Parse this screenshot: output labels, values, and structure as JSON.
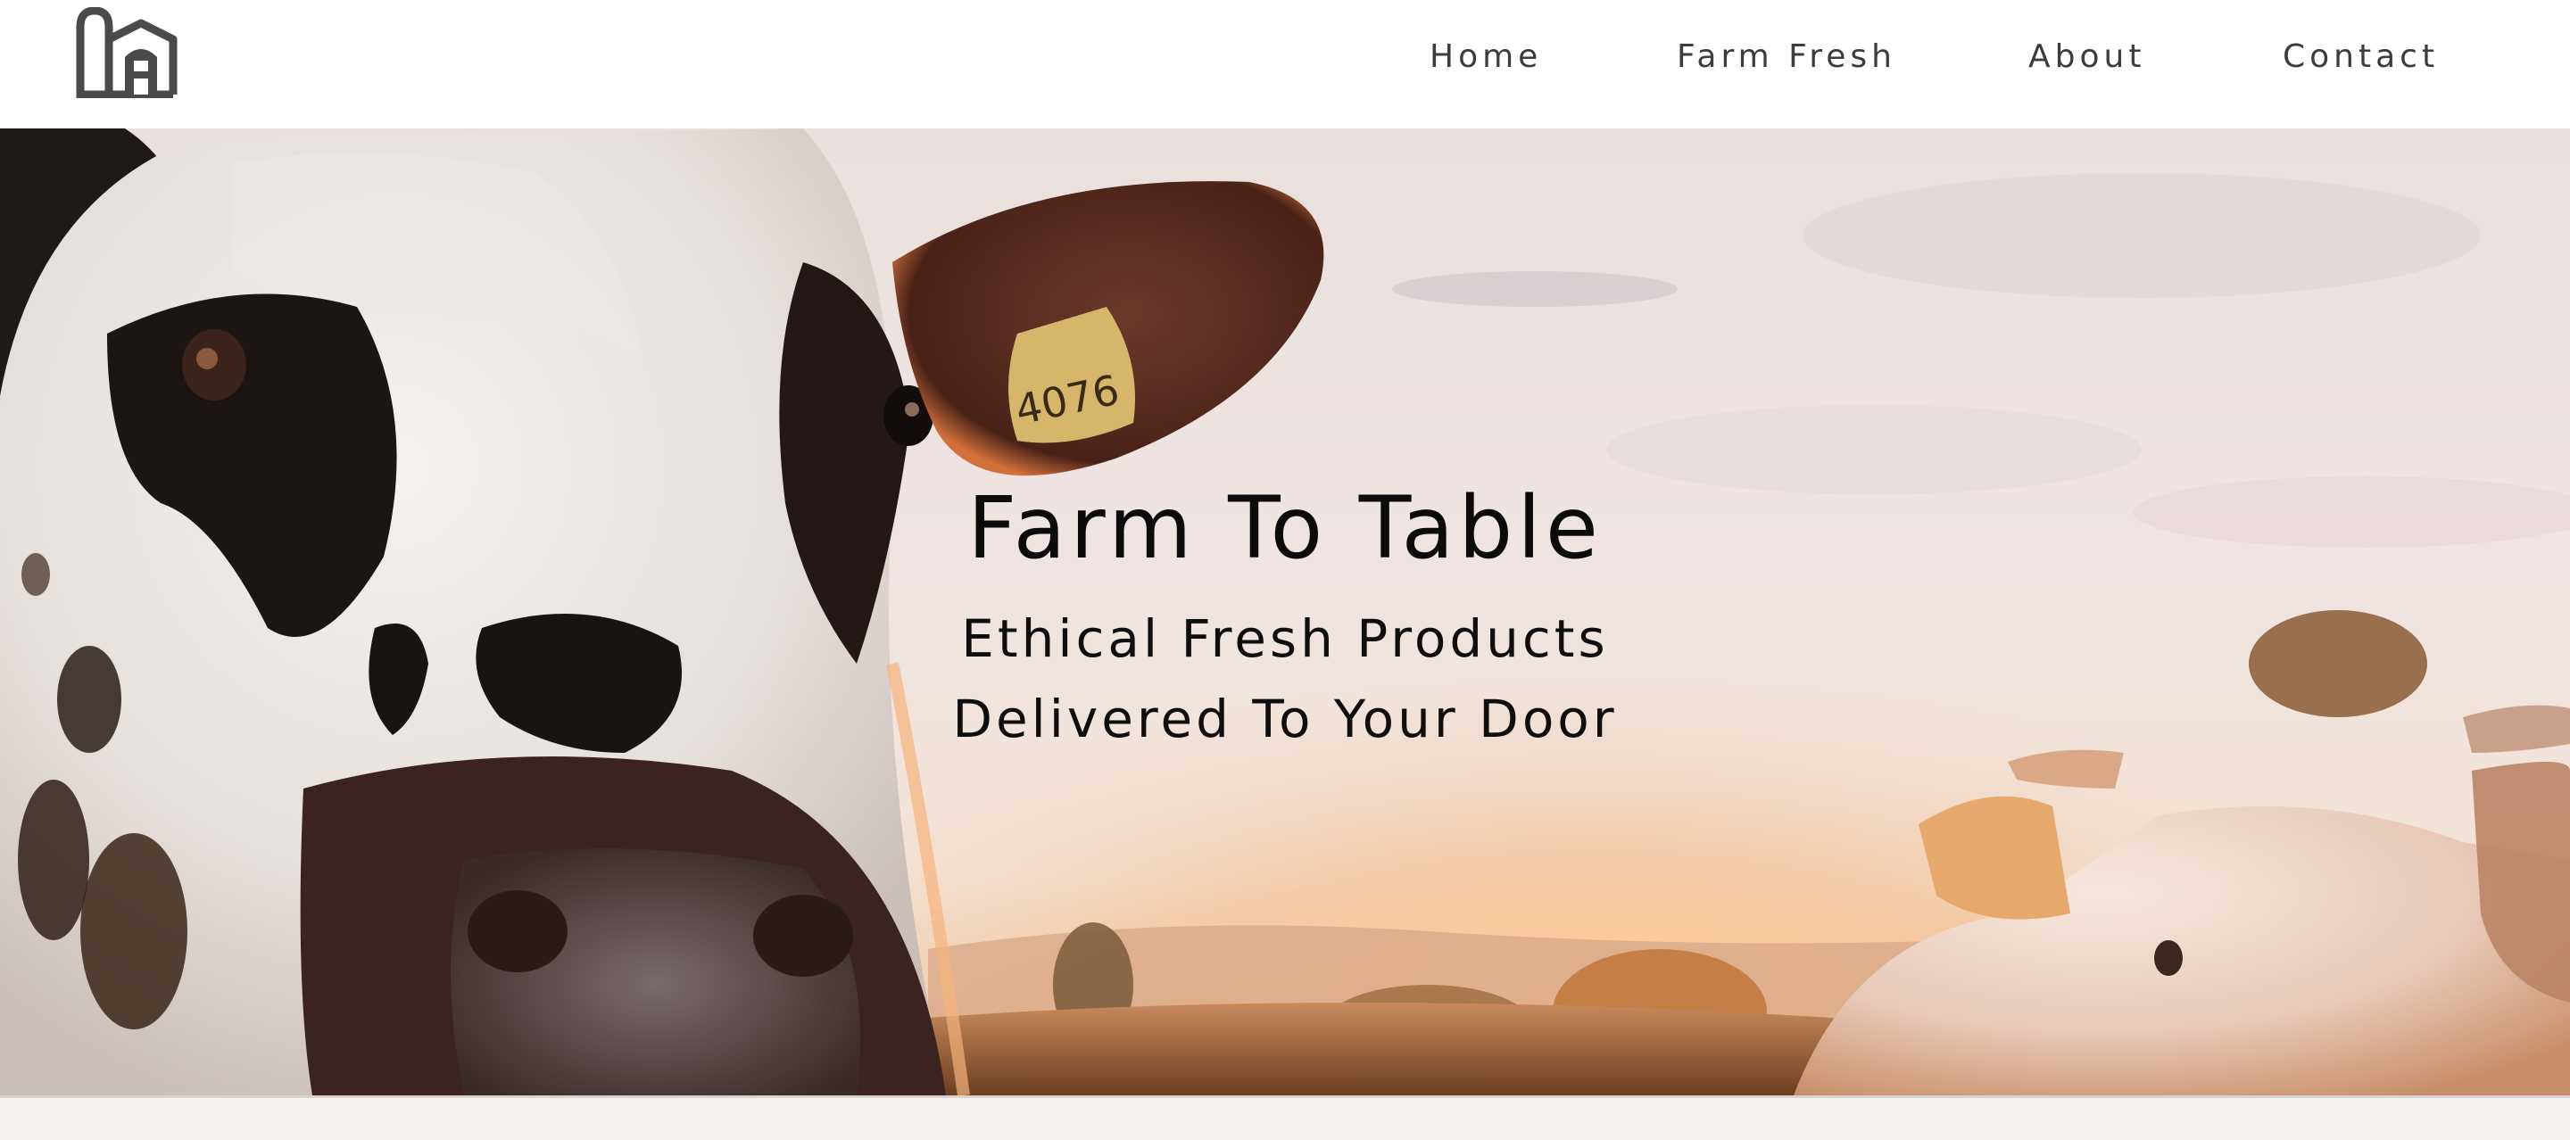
{
  "header": {
    "logo_icon": "barn-logo-icon",
    "nav": {
      "home": "Home",
      "farm_fresh": "Farm Fresh",
      "about": "About",
      "contact": "Contact"
    }
  },
  "hero": {
    "title": "Farm To Table",
    "subtitle_line1": "Ethical Fresh Products",
    "subtitle_line2": "Delivered To Your Door",
    "image": "cows-at-sunset-photo"
  },
  "colors": {
    "nav_text": "#3c3c3c",
    "hero_text": "#0b0b0b",
    "logo": "#4a4a4a",
    "sky": "#efe3df",
    "sunset": "#f09a4a"
  }
}
